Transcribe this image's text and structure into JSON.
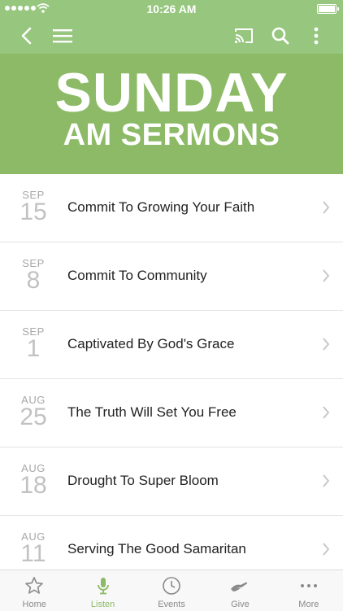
{
  "status": {
    "time": "10:26 AM"
  },
  "toolbar": {
    "back_icon": "chevron-left-icon",
    "menu_icon": "hamburger-icon",
    "cast_icon": "cast-icon",
    "search_icon": "search-icon",
    "more_icon": "vertical-dots-icon"
  },
  "hero": {
    "line1": "SUNDAY",
    "line2": "AM SERMONS"
  },
  "sermons": [
    {
      "month": "SEP",
      "day": "15",
      "title": "Commit To Growing Your Faith"
    },
    {
      "month": "SEP",
      "day": "8",
      "title": "Commit To Community"
    },
    {
      "month": "SEP",
      "day": "1",
      "title": "Captivated By God's Grace"
    },
    {
      "month": "AUG",
      "day": "25",
      "title": "The Truth Will Set You Free"
    },
    {
      "month": "AUG",
      "day": "18",
      "title": "Drought To Super Bloom"
    },
    {
      "month": "AUG",
      "day": "11",
      "title": "Serving The Good Samaritan"
    }
  ],
  "tabs": [
    {
      "label": "Home",
      "icon": "star-icon",
      "active": false
    },
    {
      "label": "Listen",
      "icon": "microphone-icon",
      "active": true
    },
    {
      "label": "Events",
      "icon": "clock-icon",
      "active": false
    },
    {
      "label": "Give",
      "icon": "giving-hand-icon",
      "active": false
    },
    {
      "label": "More",
      "icon": "more-dots-icon",
      "active": false
    }
  ],
  "colors": {
    "accent": "#8cba66",
    "toolbar": "#97c67e",
    "inactive": "#8a8a8a"
  }
}
